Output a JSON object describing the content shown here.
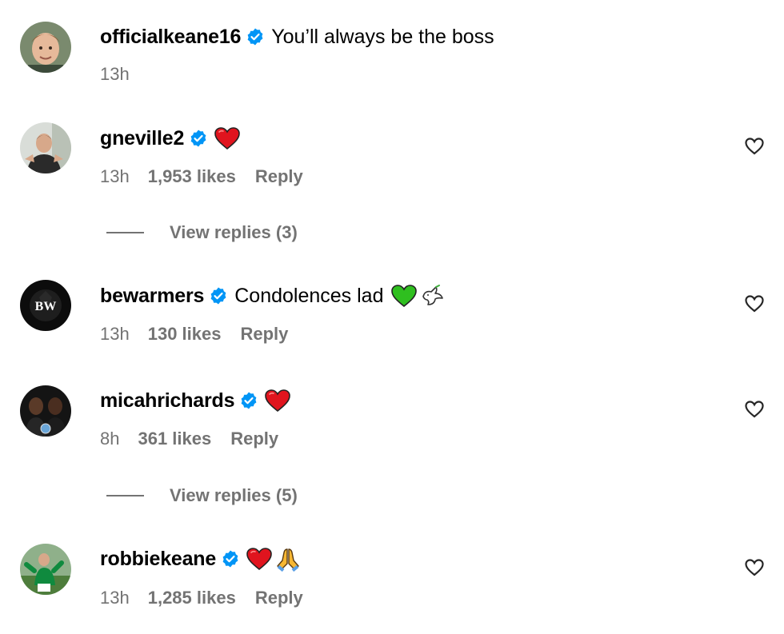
{
  "colors": {
    "text": "#000000",
    "secondary": "#737373",
    "verified": "#0095f6",
    "heart_red": "#e0141e",
    "heart_green": "#2fbf1f"
  },
  "comments": [
    {
      "username": "officialkeane16",
      "verified": true,
      "text": "You’ll always be the boss",
      "emojis": [],
      "time": "13h",
      "likes": "",
      "reply_label": ""
    },
    {
      "username": "gneville2",
      "verified": true,
      "text": "",
      "emojis": [
        "red-heart"
      ],
      "time": "13h",
      "likes": "1,953 likes",
      "reply_label": "Reply",
      "view_replies": "View replies (3)"
    },
    {
      "username": "bewarmers",
      "verified": true,
      "text": "Condolences lad",
      "emojis": [
        "green-heart",
        "dove"
      ],
      "time": "13h",
      "likes": "130 likes",
      "reply_label": "Reply",
      "avatar_text": "BW"
    },
    {
      "username": "micahrichards",
      "verified": true,
      "text": "",
      "emojis": [
        "red-heart"
      ],
      "time": "8h",
      "likes": "361 likes",
      "reply_label": "Reply",
      "view_replies": "View replies (5)"
    },
    {
      "username": "robbiekeane",
      "verified": true,
      "text": "",
      "emojis": [
        "red-heart",
        "folded-hands"
      ],
      "time": "13h",
      "likes": "1,285 likes",
      "reply_label": "Reply"
    }
  ]
}
